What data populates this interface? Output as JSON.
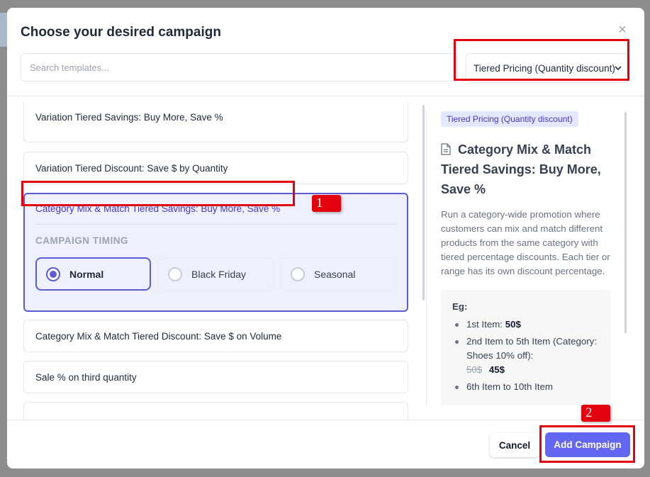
{
  "modal": {
    "title": "Choose your desired campaign",
    "close_glyph": "×"
  },
  "search": {
    "placeholder": "Search templates..."
  },
  "category_select": {
    "value": "Tiered Pricing (Quantity discount)"
  },
  "templates": [
    {
      "label": "Variation Tiered Savings: Buy More, Save %"
    },
    {
      "label": "Variation Tiered Discount: Save $ by Quantity"
    },
    {
      "label": "Category Mix & Match Tiered Savings: Buy More, Save %",
      "selected": true,
      "timing_label": "CAMPAIGN TIMING",
      "timing_options": [
        {
          "label": "Normal",
          "checked": true
        },
        {
          "label": "Black Friday",
          "checked": false
        },
        {
          "label": "Seasonal",
          "checked": false
        }
      ]
    },
    {
      "label": "Category Mix & Match Tiered Discount: Save $ on Volume"
    },
    {
      "label": "Sale % on third quantity"
    }
  ],
  "preview": {
    "tag": "Tiered Pricing (Quantity discount)",
    "title": "Category Mix & Match Tiered Savings: Buy More, Save %",
    "description": "Run a category-wide promotion where customers can mix and match different products from the same category with tiered percentage discounts. Each tier or range has its own discount percentage.",
    "example": {
      "heading": "Eg:",
      "items": [
        {
          "label": "1st Item:",
          "price": "50$"
        },
        {
          "label": "2nd Item to 5th Item (Category: Shoes 10% off):",
          "old_price": "50$",
          "price": "45$"
        },
        {
          "label": "6th Item to 10th Item"
        }
      ]
    }
  },
  "footer": {
    "cancel_label": "Cancel",
    "add_label": "Add Campaign"
  },
  "annotations": {
    "badge_1": "1",
    "badge_2": "2"
  },
  "colors": {
    "accent": "#6366f1",
    "selected_border": "#5b5bd6",
    "annotation_red": "#e3000f"
  },
  "icons": {
    "close": "close-icon",
    "dropdown": "chevron-down-icon",
    "preview_title": "document-icon"
  }
}
